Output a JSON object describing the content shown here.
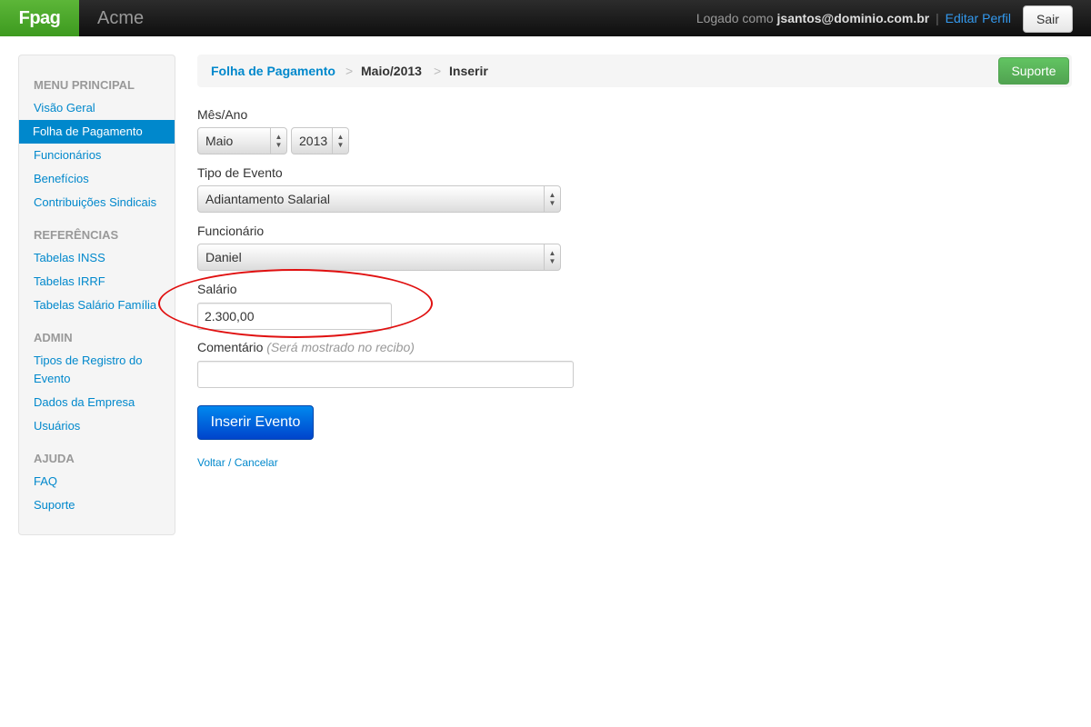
{
  "navbar": {
    "brand": "Fpag",
    "company": "Acme",
    "logged_as": "Logado como",
    "user": "jsantos@dominio.com.br",
    "separator": "|",
    "edit_profile": "Editar Perfil",
    "logout": "Sair"
  },
  "sidebar": {
    "sections": {
      "main": "MENU PRINCIPAL",
      "refs": "REFERÊNCIAS",
      "admin": "ADMIN",
      "help": "AJUDA"
    },
    "items": {
      "overview": "Visão Geral",
      "payroll": "Folha de Pagamento",
      "employees": "Funcionários",
      "benefits": "Benefícios",
      "union": "Contribuições Sindicais",
      "inss": "Tabelas INSS",
      "irrf": "Tabelas IRRF",
      "family": "Tabelas Salário Família",
      "event_types": "Tipos de Registro do Evento",
      "company_data": "Dados da Empresa",
      "users": "Usuários",
      "faq": "FAQ",
      "support": "Suporte"
    },
    "active_item": "payroll"
  },
  "breadcrumb": {
    "items": [
      "Folha de Pagamento",
      "Maio/2013",
      "Inserir"
    ],
    "separator": ">",
    "support_button": "Suporte"
  },
  "form": {
    "month_year_label": "Mês/Ano",
    "month": "Maio",
    "year": "2013",
    "event_type_label": "Tipo de Evento",
    "event_type": "Adiantamento Salarial",
    "employee_label": "Funcionário",
    "employee": "Daniel",
    "salary_label": "Salário",
    "salary_value": "2.300,00",
    "comment_label": "Comentário",
    "comment_hint": "(Será mostrado no recibo)",
    "comment_value": "",
    "submit": "Inserir Evento",
    "cancel": "Voltar / Cancelar"
  },
  "colors": {
    "brand_green": "#4fa92b",
    "link_blue": "#0088cc",
    "primary_blue": "#0055dd",
    "success_green": "#5bb75b",
    "annotation_red": "#e01010"
  }
}
